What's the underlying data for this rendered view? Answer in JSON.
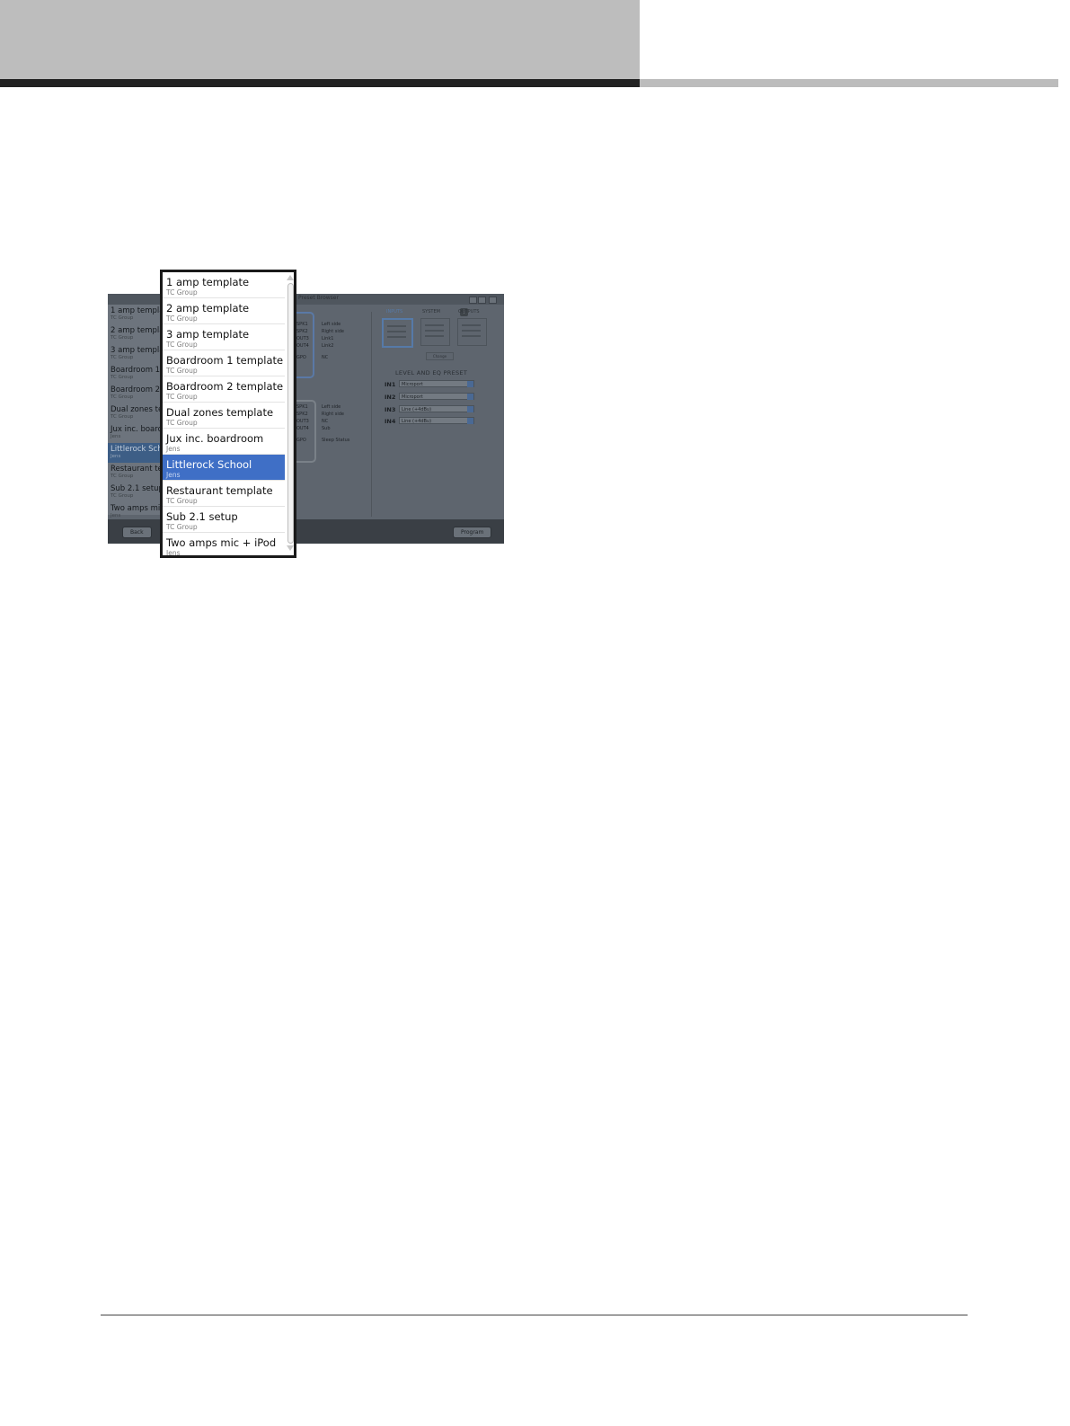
{
  "window": {
    "title": "Preset Browser",
    "help_label": "i",
    "back_label": "Back",
    "program_label": "Program"
  },
  "left_list": [
    {
      "title": "1 amp template",
      "sub": "TC Group"
    },
    {
      "title": "2 amp template",
      "sub": "TC Group"
    },
    {
      "title": "3 amp template",
      "sub": "TC Group"
    },
    {
      "title": "Boardroom 1 template",
      "sub": "TC Group"
    },
    {
      "title": "Boardroom 2 template",
      "sub": "TC Group"
    },
    {
      "title": "Dual zones template",
      "sub": "TC Group"
    },
    {
      "title": "Jux inc. boardroom",
      "sub": "Jens"
    },
    {
      "title": "Littlerock School",
      "sub": "Jens"
    },
    {
      "title": "Restaurant template",
      "sub": "TC Group"
    },
    {
      "title": "Sub 2.1 setup",
      "sub": "TC Group"
    },
    {
      "title": "Two amps mic + iPod",
      "sub": "Jens"
    }
  ],
  "amp1": {
    "rows": [
      {
        "port": "SPK1",
        "name": "Left side"
      },
      {
        "port": "SPK2",
        "name": "Right side"
      },
      {
        "port": "OUT3",
        "name": "Link1"
      },
      {
        "port": "OUT4",
        "name": "Link2"
      },
      {
        "port": "GPO",
        "name": "NC"
      }
    ]
  },
  "amp2": {
    "rows": [
      {
        "port": "SPK1",
        "name": "Left side"
      },
      {
        "port": "SPK2",
        "name": "Right side"
      },
      {
        "port": "OUT3",
        "name": "NC"
      },
      {
        "port": "OUT4",
        "name": "Sub"
      },
      {
        "port": "GPO",
        "name": "Sleep Status"
      }
    ]
  },
  "tabs": [
    "INPUTS",
    "SYSTEM",
    "OUTPUTS"
  ],
  "tab_button": "Change",
  "level_title": "LEVEL AND EQ PRESET",
  "inputs": [
    {
      "name": "IN1",
      "value": "Microport"
    },
    {
      "name": "IN2",
      "value": "Microport"
    },
    {
      "name": "IN3",
      "value": "Line (+4dBu)"
    },
    {
      "name": "IN4",
      "value": "Line (+4dBu)"
    }
  ],
  "popup": {
    "selected_index": 7,
    "items": [
      {
        "title": "1 amp template",
        "sub": "TC Group"
      },
      {
        "title": "2 amp template",
        "sub": "TC Group"
      },
      {
        "title": "3 amp template",
        "sub": "TC Group"
      },
      {
        "title": "Boardroom 1 template",
        "sub": "TC Group"
      },
      {
        "title": "Boardroom 2 template",
        "sub": "TC Group"
      },
      {
        "title": "Dual zones template",
        "sub": "TC Group"
      },
      {
        "title": "Jux inc. boardroom",
        "sub": "Jens"
      },
      {
        "title": "Littlerock School",
        "sub": "Jens"
      },
      {
        "title": "Restaurant template",
        "sub": "TC Group"
      },
      {
        "title": "Sub 2.1 setup",
        "sub": "TC Group"
      },
      {
        "title": "Two amps mic + iPod",
        "sub": "Jens"
      }
    ]
  }
}
